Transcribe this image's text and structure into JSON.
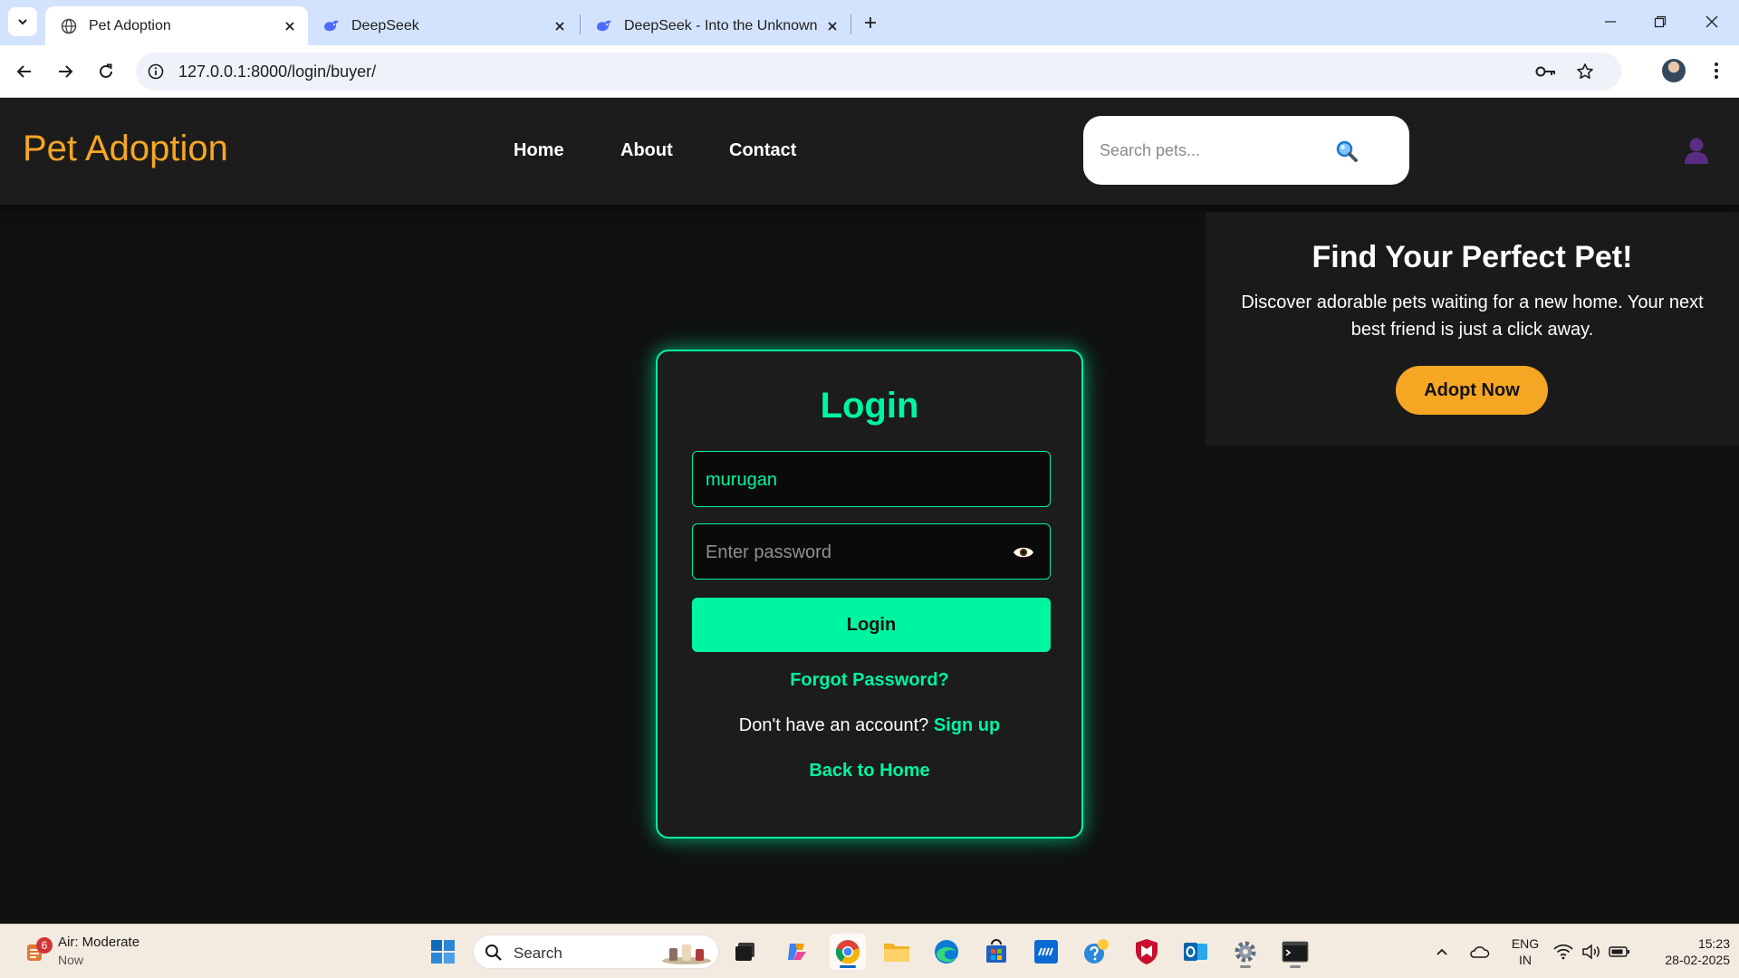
{
  "browser": {
    "tabs": [
      {
        "title": "Pet Adoption",
        "active": true
      },
      {
        "title": "DeepSeek",
        "active": false
      },
      {
        "title": "DeepSeek - Into the Unknown",
        "active": false
      }
    ],
    "url": "127.0.0.1:8000/login/buyer/"
  },
  "site": {
    "brand": "Pet Adoption",
    "nav": [
      "Home",
      "About",
      "Contact"
    ],
    "search_placeholder": "Search pets...",
    "brand_color": "#f5a623",
    "accent_color": "#00f5a0"
  },
  "hero": {
    "title": "Find Your Perfect Pet!",
    "text": "Discover adorable pets waiting for a new home. Your next best friend is just a click away.",
    "button": "Adopt Now"
  },
  "login": {
    "title": "Login",
    "username_value": "murugan",
    "password_placeholder": "Enter password",
    "button": "Login",
    "forgot": "Forgot Password?",
    "signup_prompt": "Don't have an account?",
    "signup_link": "Sign up",
    "back_home": "Back to Home"
  },
  "taskbar": {
    "weather_title": "Air: Moderate",
    "weather_sub": "Now",
    "weather_badge": "6",
    "search_label": "Search",
    "lang_line1": "ENG",
    "lang_line2": "IN",
    "time": "15:23",
    "date": "28-02-2025"
  }
}
